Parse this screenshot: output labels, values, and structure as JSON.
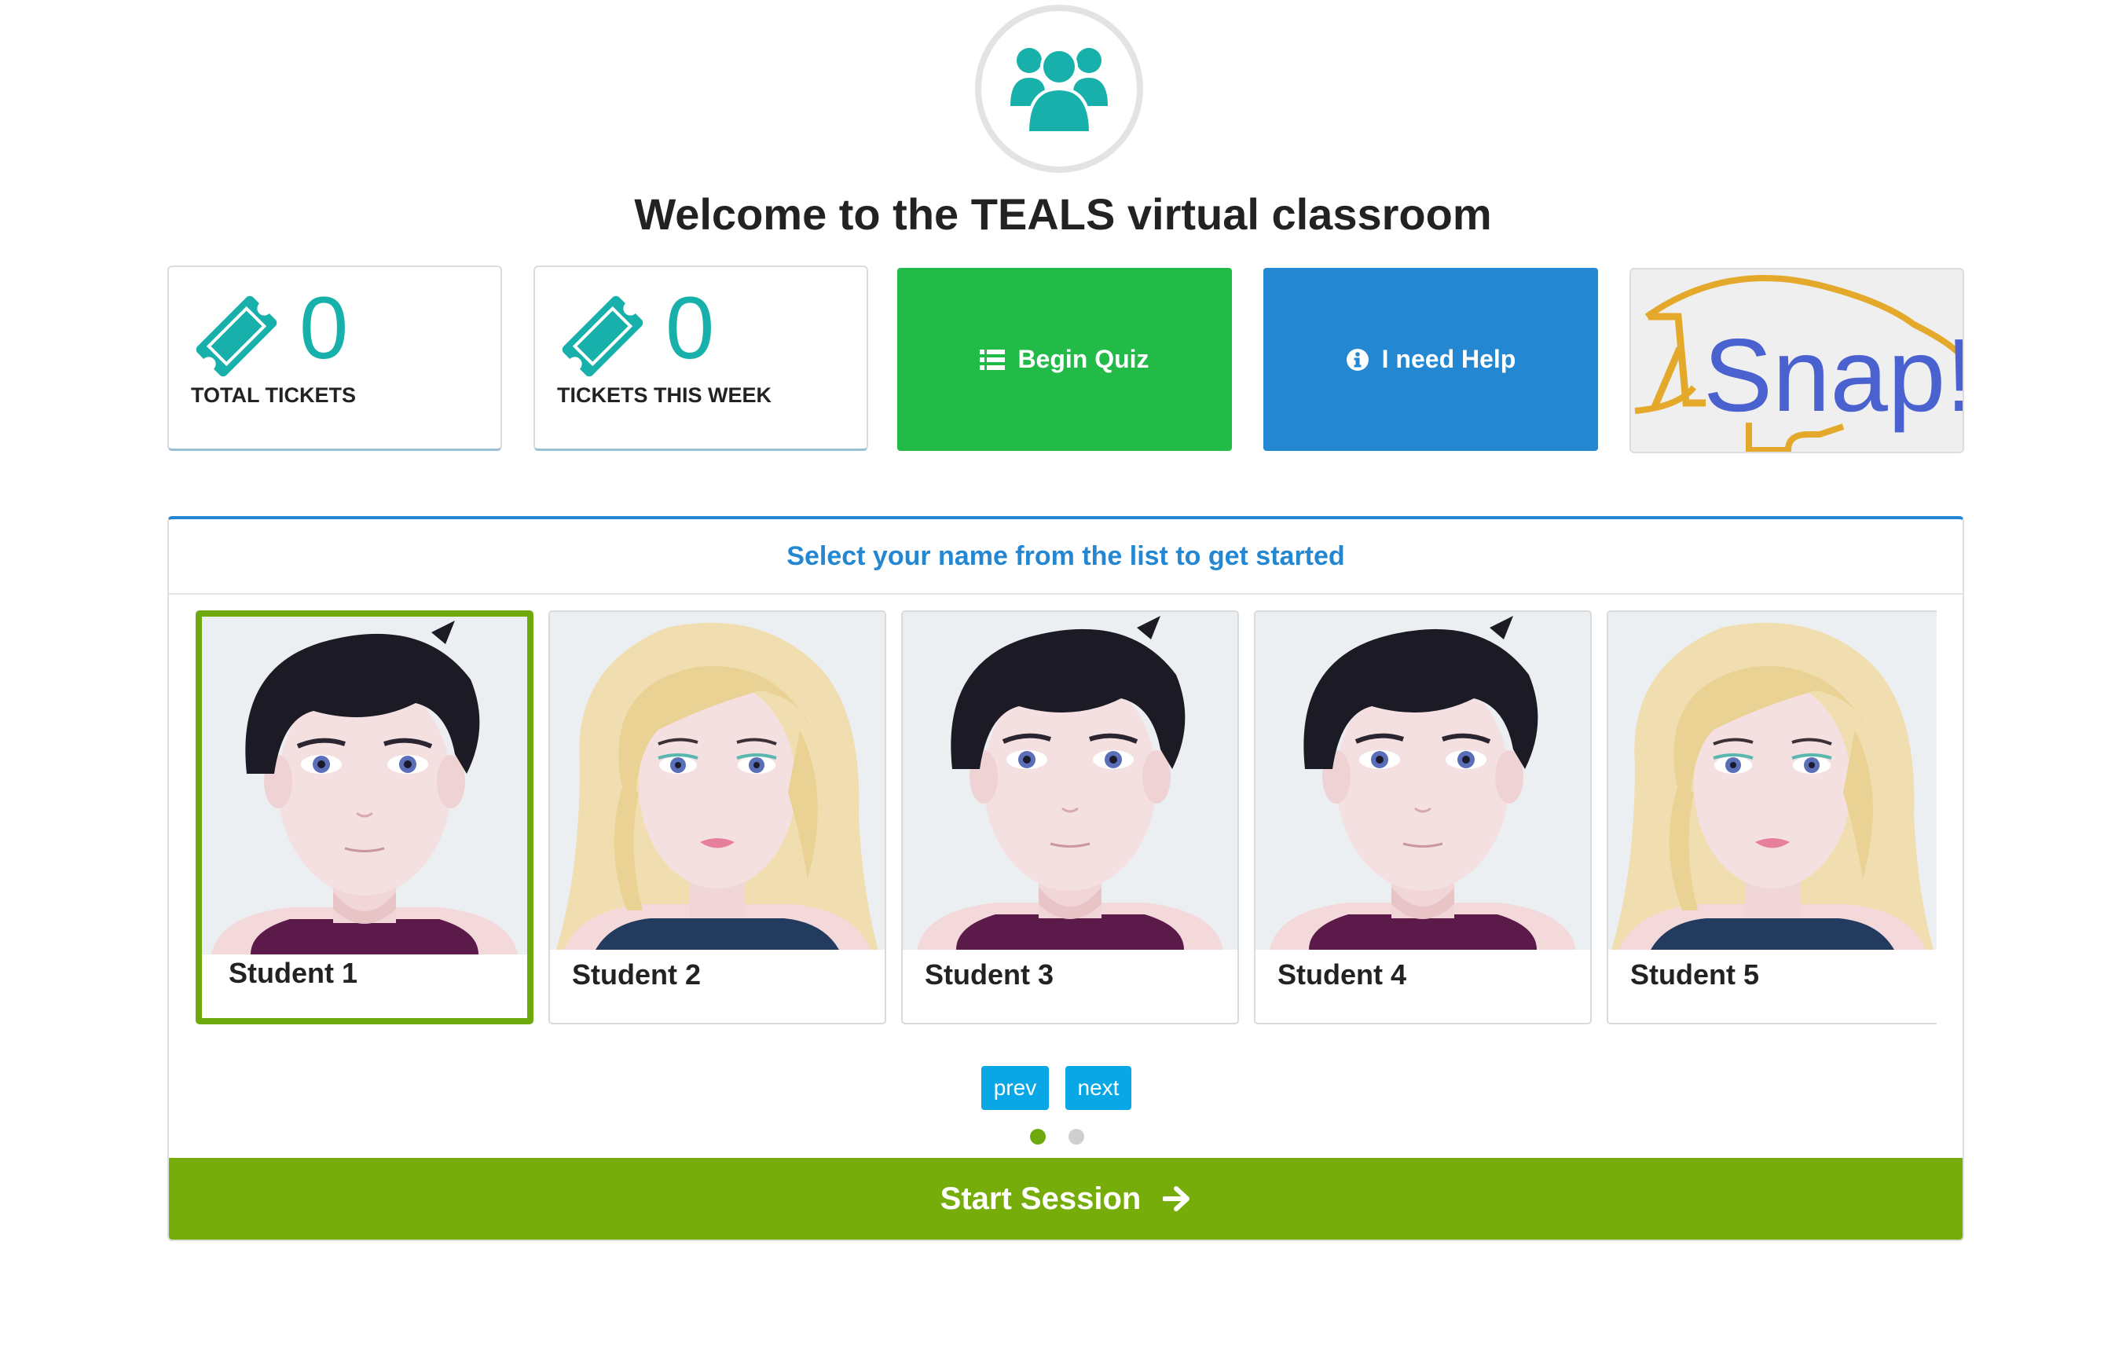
{
  "header": {
    "icon": "users-group-icon",
    "title": "Welcome to the TEALS virtual classroom"
  },
  "stats": [
    {
      "value": "0",
      "label": "TOTAL TICKETS",
      "icon": "ticket-icon"
    },
    {
      "value": "0",
      "label": "TICKETS THIS WEEK",
      "icon": "ticket-icon"
    }
  ],
  "actions": {
    "quiz_label": "Begin Quiz",
    "quiz_icon": "list-icon",
    "help_label": "I need Help",
    "help_icon": "info-circle-icon"
  },
  "snap": {
    "logo_text": "Snap!"
  },
  "panel": {
    "heading": "Select your name from the list to get started",
    "students": [
      {
        "name": "Student 1",
        "avatar": "boy-avatar",
        "selected": true
      },
      {
        "name": "Student 2",
        "avatar": "girl-avatar",
        "selected": false
      },
      {
        "name": "Student 3",
        "avatar": "boy-avatar",
        "selected": false
      },
      {
        "name": "Student 4",
        "avatar": "boy-avatar",
        "selected": false
      },
      {
        "name": "Student 5",
        "avatar": "girl-avatar",
        "selected": false
      }
    ],
    "prev_label": "prev",
    "next_label": "next",
    "pages": 2,
    "current_page": 1,
    "start_label": "Start Session"
  },
  "colors": {
    "teal": "#17b0aa",
    "quiz_green": "#22bb48",
    "help_blue": "#2487d2",
    "start_green": "#77ad0a",
    "pager_blue": "#0aa7e6"
  }
}
